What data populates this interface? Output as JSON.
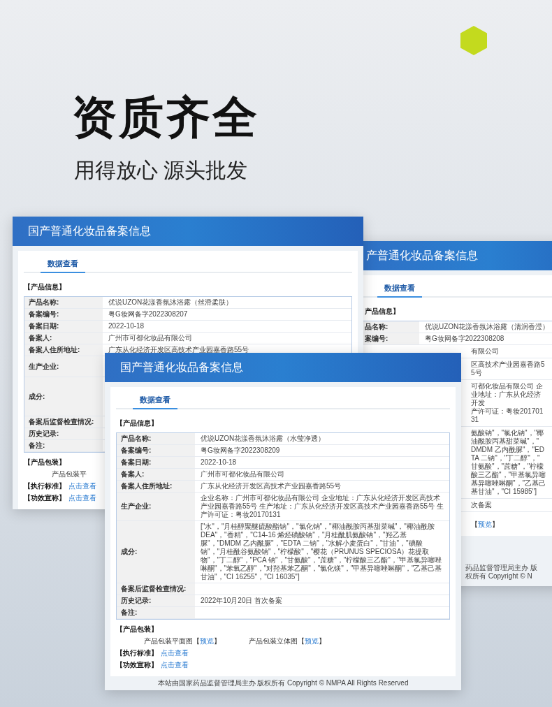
{
  "headline": "资质齐全",
  "subtitle": "用得放心 源头批发",
  "windows": [
    {
      "title": "国产普通化妆品备案信息",
      "tab": {
        "label": "数据查看",
        "selected": true
      },
      "section": "【产品信息】",
      "rows": [
        {
          "kind": "line",
          "label": "产品名称:",
          "value": "优说UZON花漾香氛沐浴露（丝滑柔肤）"
        },
        {
          "kind": "line",
          "label": "备案编号:",
          "value": "粤G妆网备字2022308207"
        },
        {
          "kind": "line",
          "label": "备案日期:",
          "value": "2022-10-18"
        },
        {
          "kind": "line",
          "label": "备案人:",
          "value": "广州市可都化妆品有限公司"
        },
        {
          "kind": "line",
          "label": "备案人住所地址:",
          "value": "广东从化经济开发区高技术产业园嘉香路55号"
        },
        {
          "kind": "block",
          "label": "生产企业:"
        },
        {
          "kind": "list",
          "label": "成分:"
        },
        {
          "kind": "line",
          "label": "备案后监督检查情况:"
        },
        {
          "kind": "line",
          "label": "历史记录:"
        },
        {
          "kind": "line",
          "label": "备注:"
        }
      ],
      "package": {
        "title": "【产品包装】",
        "items": [
          {
            "text": "产品包装平"
          }
        ]
      },
      "extras": [
        {
          "label": "【执行标准】",
          "link": "点击查看"
        },
        {
          "label": "【功效宣称】",
          "link": "点击查看"
        }
      ]
    },
    {
      "title": "产普通化妆品备案信息",
      "tab": {
        "label": "数据查看",
        "selected": true
      },
      "section": "产品信息】",
      "rows": [
        {
          "kind": "line",
          "label": "品名称:",
          "value": "优说UZON花漾香氛沐浴露（清润香滢）"
        },
        {
          "kind": "line",
          "label": "案编号:",
          "value": "粤G妆网备字2022308208"
        }
      ],
      "fragments": [
        {
          "kind": "row",
          "lines": [
            "有限公司"
          ]
        },
        {
          "kind": "row",
          "lines": [
            "区高技术产业园嘉香路55号"
          ]
        },
        {
          "kind": "row",
          "lines": [
            "可都化妆品有限公司 企业地址：广东从化经济开发",
            "产许可证：粤妆20170131"
          ]
        },
        {
          "kind": "row",
          "lines": [
            "氨酸钠\"，\"氯化钠\"，\"椰油酰胺丙基甜菜碱\"，\"",
            "DMDM 乙内酰脲\"，\"EDTA 二钠\"，\"丁二醇\"，\"",
            "甘氨酸\"，\"蔗糖\"，\"柠檬酸三乙酯\"，\"甲基氯异噻",
            "基异噻唑啉酮\"，\"乙基己基甘油\"，\"CI 15985\"]"
          ]
        },
        {
          "kind": "row",
          "lines": [
            "次备案"
          ]
        },
        {
          "kind": "link",
          "brackets": [
            "【",
            "】"
          ],
          "link": "预览"
        },
        {
          "kind": "footer",
          "lines": [
            "药品监督管理局主办 版权所有 Copyright © N"
          ]
        }
      ]
    },
    {
      "title": "国产普通化妆品备案信息",
      "tab": {
        "label": "数据查看",
        "selected": true
      },
      "section": "【产品信息】",
      "rows": [
        {
          "kind": "line",
          "label": "产品名称:",
          "value": "优说UZON花漾香氛沐浴露（水莹净透）"
        },
        {
          "kind": "line",
          "label": "备案编号:",
          "value": "粤G妆网备字2022308209"
        },
        {
          "kind": "line",
          "label": "备案日期:",
          "value": "2022-10-18"
        },
        {
          "kind": "line",
          "label": "备案人:",
          "value": "广州市可都化妆品有限公司"
        },
        {
          "kind": "line",
          "label": "备案人住所地址:",
          "value": "广东从化经济开发区高技术产业园嘉香路55号"
        },
        {
          "kind": "block",
          "label": "生产企业:",
          "value": "企业名称：广州市可都化妆品有限公司 企业地址：广东从化经济开发区高技术产业园嘉香路55号 生产地址：广东从化经济开发区高技术产业园嘉香路55号 生产许可证：粤妆20170131"
        },
        {
          "kind": "list",
          "label": "成分:",
          "value": "[\"水\"，\"月桂醇聚醚硫酸酯钠\"，\"氯化钠\"，\"椰油酰胺丙基甜菜碱\"，\"椰油酰胺 DEA\"，\"香精\"，\"C14-16 烯烃磺酸钠\"，\"月桂酰肌氨酸钠\"，\"羟乙基脲\"，\"DMDM 乙内酰脲\"，\"EDTA 二钠\"，\"水解小麦蛋白\"，\"甘油\"，\"碘酸钠\"，\"月桂酰谷氨酸钠\"，\"柠檬酸\"，\"樱花（PRUNUS SPECIOSA）花提取物\"，\"丁二醇\"，\"PCA 钠\"，\"甘氨酸\"，\"蔗糖\"，\"柠檬酸三乙酯\"，\"甲基氯异噻唑啉酮\"，\"苯氧乙醇\"，\"对羟基苯乙酮\"，\"氯化镁\"，\"甲基异噻唑啉酮\"，\"乙基己基甘油\"，\"CI 16255\"，\"CI 16035\"]"
        },
        {
          "kind": "line",
          "label": "备案后监督检查情况:"
        },
        {
          "kind": "line",
          "label": "历史记录:",
          "value": "2022年10月20日 首次备案"
        },
        {
          "kind": "line",
          "label": "备注:"
        }
      ],
      "package": {
        "title": "【产品包装】",
        "items": [
          {
            "text": "产品包装平面图",
            "brackets": [
              "【",
              "】"
            ],
            "link": "预览"
          },
          {
            "text": "产品包装立体图",
            "brackets": [
              "【",
              "】"
            ],
            "link": "预览"
          }
        ]
      },
      "extras": [
        {
          "label": "【执行标准】",
          "link": "点击查看"
        },
        {
          "label": "【功效宣称】",
          "link": "点击查看"
        }
      ],
      "footer": "本站由国家药品监督管理局主办 版权所有 Copyright © NMPA All Rights Reserved"
    }
  ]
}
